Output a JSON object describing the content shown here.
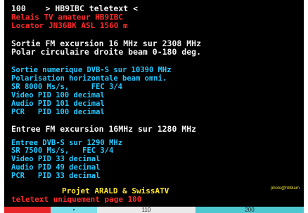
{
  "header": {
    "page": "100",
    "title": "> HB9IBC teletext <"
  },
  "station": {
    "line1": "Relais TV amateur HB9IBC",
    "line2": "Locator JN36BK ASL 1560 m"
  },
  "sortie_fm": {
    "line1": "Sortie FM excursion 16 MHz sur 2308 MHz",
    "line2": "Polar circulaire droite beam 0-180 deg."
  },
  "sortie_num": {
    "line1": "Sortie numerique DVB-S sur 10390 MHz",
    "line2": "Polarisation horizontale beam omni.",
    "line3": "SR 8000 Ms/s,     FEC 3/4",
    "line4": "Video PID 100 decimal",
    "line5": "Audio PID 101 decimal",
    "line6": "PCR   PID 100 decimal"
  },
  "entree_fm": {
    "line1": "Entree FM excursion 16MHz sur 1280 MHz"
  },
  "entree_num": {
    "line1": "Entree DVB-S sur 1290 MHz",
    "line2": "SR 7500 Ms/s,   FEC 3/4",
    "line3": "Video PID 33 decimal",
    "line4": "Audio PID 49 decimal",
    "line5": "PCR   PID 33 decimal"
  },
  "footer": {
    "projet": "Projet ARALD & SwissATV",
    "notice": "teletext uniquement page 100",
    "photo_credit": "photo@hb9iarn"
  },
  "fastext": {
    "items": [
      {
        "label": "",
        "color": "#e8262a"
      },
      {
        "label": "•",
        "color": "#7ee0ea"
      },
      {
        "label": "110",
        "color": "#eaeaea"
      },
      {
        "label": "200",
        "color": "#4ec8d0"
      }
    ]
  }
}
